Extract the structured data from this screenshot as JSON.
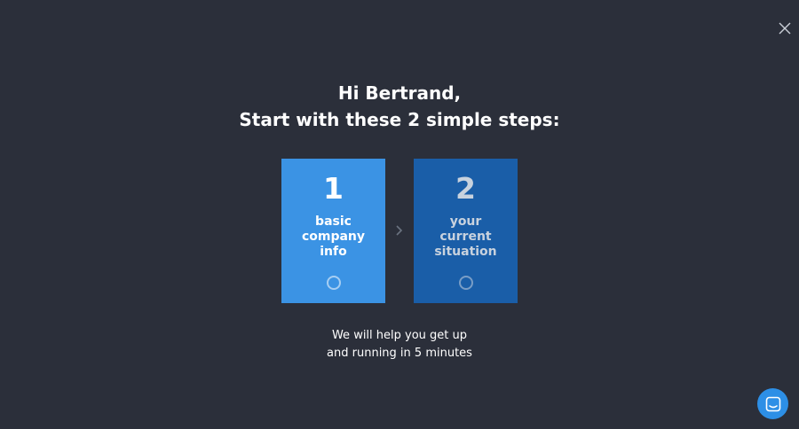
{
  "header": {
    "greeting": "Hi Bertrand,",
    "subtitle": "Start with these 2 simple steps:"
  },
  "steps": [
    {
      "number": "1",
      "label_lines": [
        "basic",
        "company",
        "info"
      ],
      "color": "#3b93e4"
    },
    {
      "number": "2",
      "label_lines": [
        "your",
        "current",
        "situation"
      ],
      "color": "#1a5ea8"
    }
  ],
  "footer": {
    "line1": "We will help you get up",
    "line2": "and running in 5 minutes"
  },
  "icons": {
    "close": "close-icon",
    "arrow": "chevron-right-icon",
    "chat": "chat-icon"
  },
  "colors": {
    "background": "#2b2f3a",
    "chat_button": "#2d8fe6"
  }
}
